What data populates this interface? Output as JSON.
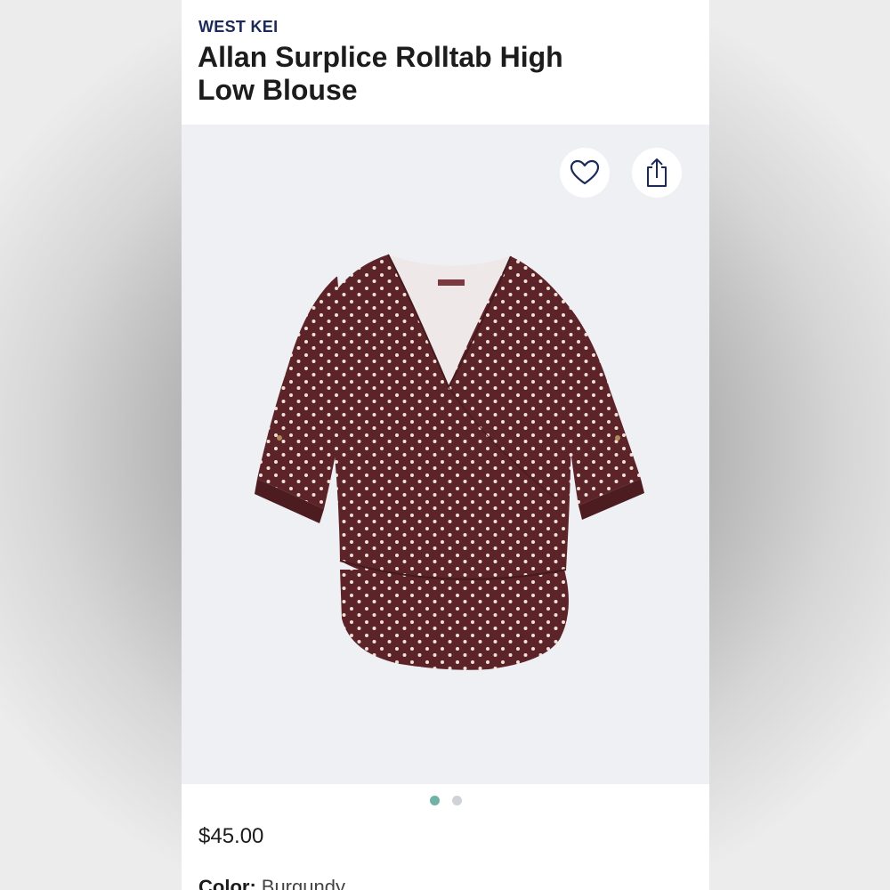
{
  "product": {
    "brand": "WEST KEI",
    "title": "Allan Surplice Rolltab High Low Blouse",
    "price": "$45.00",
    "color_label": "Color:",
    "color_value": "Burgundy"
  },
  "gallery": {
    "image_name": "burgundy-polka-dot-blouse",
    "garment_color": "#5c2328",
    "dot_color": "#efe2d6",
    "background": "#eff0f3",
    "active_index": 1,
    "total_images": 2
  },
  "actions": {
    "favorite_icon": "heart-icon",
    "share_icon": "share-icon",
    "icon_color": "#1b2a5a"
  },
  "pagination": {
    "active_color": "#6fb3a5",
    "inactive_color": "#cfd2d6"
  }
}
